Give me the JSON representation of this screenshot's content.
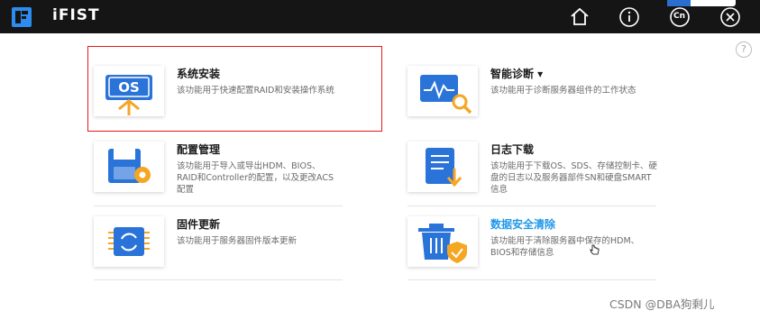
{
  "app": {
    "title": "iFIST"
  },
  "header": {
    "icons": [
      "home-icon",
      "info-icon",
      "language-icon",
      "close-icon"
    ],
    "language_label": "Cn"
  },
  "help": {
    "label": "?"
  },
  "cards": [
    {
      "title": "系统安装",
      "desc": "该功能用于快速配置RAID和安装操作系统",
      "icon": "os-install-icon"
    },
    {
      "title": "智能诊断 ▾",
      "desc": "该功能用于诊断服务器组件的工作状态",
      "icon": "diagnosis-icon"
    },
    {
      "title": "配置管理",
      "desc": "该功能用于导入或导出HDM、BIOS、RAID和Controller的配置，以及更改ACS配置",
      "icon": "config-icon"
    },
    {
      "title": "日志下载",
      "desc": "该功能用于下载OS、SDS、存储控制卡、硬盘的日志以及服务器部件SN和硬盘SMART信息",
      "icon": "log-download-icon"
    },
    {
      "title": "固件更新",
      "desc": "该功能用于服务器固件版本更新",
      "icon": "firmware-icon"
    },
    {
      "title": "数据安全清除",
      "desc": "该功能用于清除服务器中保存的HDM、BIOS和存储信息",
      "icon": "secure-erase-icon"
    }
  ],
  "colors": {
    "topbar": "#151515",
    "accent": "#1f97e8",
    "highlight": "#e11b1b",
    "orange": "#f5a623"
  },
  "watermark": "CSDN @DBA狗剩儿"
}
